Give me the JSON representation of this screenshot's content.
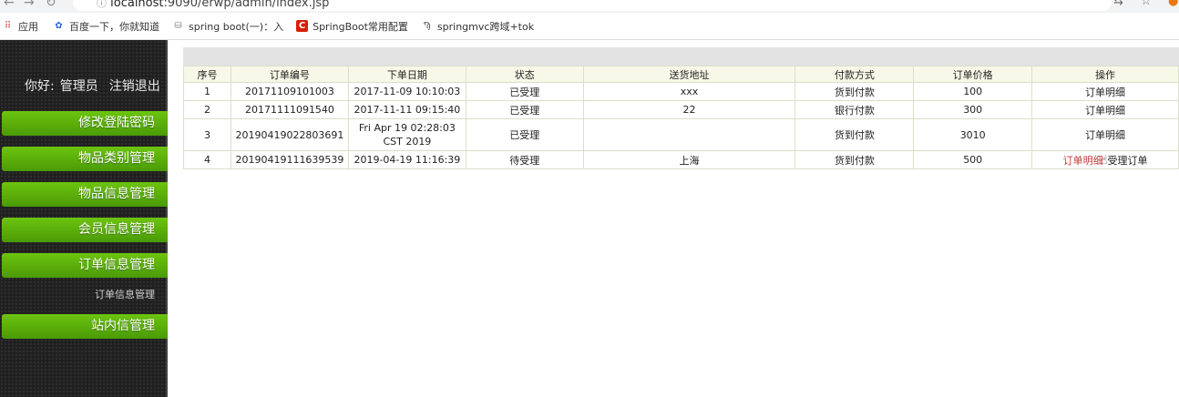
{
  "browser": {
    "url_host": "localhost",
    "url_path": ":9090/erwp/admin/index.jsp",
    "bookmarks": [
      {
        "label": "应用",
        "icon": "apps-grid-icon"
      },
      {
        "label": "百度一下，你就知道",
        "icon": "baidu-paw-icon"
      },
      {
        "label": "spring boot(一)：入",
        "icon": "database-icon"
      },
      {
        "label": "SpringBoot常用配置",
        "icon": "csdn-c-icon"
      },
      {
        "label": "springmvc跨域+tok",
        "icon": "sketch-icon"
      }
    ]
  },
  "sidebar": {
    "greeting": "你好:",
    "username": "管理员",
    "logout": "注销退出",
    "menu": [
      {
        "label": "修改登陆密码"
      },
      {
        "label": "物品类别管理"
      },
      {
        "label": "物品信息管理"
      },
      {
        "label": "会员信息管理"
      },
      {
        "label": "订单信息管理"
      },
      {
        "label": "站内信管理"
      }
    ],
    "submenu_label": "订单信息管理"
  },
  "table": {
    "headers": [
      "序号",
      "订单编号",
      "下单日期",
      "状态",
      "送货地址",
      "付款方式",
      "订单价格",
      "操作"
    ],
    "rows": [
      {
        "no": "1",
        "order_id": "20171109101003",
        "date": "2017-11-09 10:10:03",
        "status": "已受理",
        "address": "xxx",
        "payment": "货到付款",
        "price": "100",
        "action": "订单明细",
        "action2": ""
      },
      {
        "no": "2",
        "order_id": "20171111091540",
        "date": "2017-11-11 09:15:40",
        "status": "已受理",
        "address": "22",
        "payment": "银行付款",
        "price": "300",
        "action": "订单明细",
        "action2": ""
      },
      {
        "no": "3",
        "order_id": "20190419022803691",
        "date": "Fri Apr 19 02:28:03 CST 2019",
        "status": "已受理",
        "address": "",
        "payment": "货到付款",
        "price": "3010",
        "action": "订单明细",
        "action2": ""
      },
      {
        "no": "4",
        "order_id": "20190419111639539",
        "date": "2019-04-19 11:16:39",
        "status": "待受理",
        "address": "上海",
        "payment": "货到付款",
        "price": "500",
        "action": "订单明细",
        "action2": "受理订单"
      }
    ]
  }
}
